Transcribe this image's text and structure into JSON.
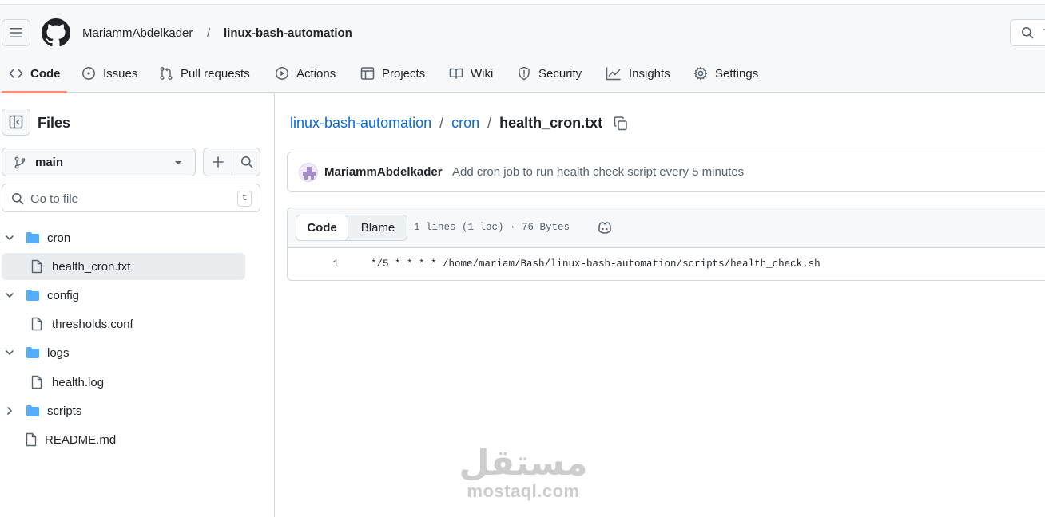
{
  "header": {
    "owner": "MariammAbdelkader",
    "separator": "/",
    "repo": "linux-bash-automation",
    "search_hint": "T"
  },
  "tabs": [
    {
      "label": "Code",
      "icon": "code-icon",
      "active": true
    },
    {
      "label": "Issues",
      "icon": "issue-opened-icon"
    },
    {
      "label": "Pull requests",
      "icon": "git-pull-request-icon"
    },
    {
      "label": "Actions",
      "icon": "play-icon"
    },
    {
      "label": "Projects",
      "icon": "table-icon"
    },
    {
      "label": "Wiki",
      "icon": "book-icon"
    },
    {
      "label": "Security",
      "icon": "shield-icon"
    },
    {
      "label": "Insights",
      "icon": "graph-icon"
    },
    {
      "label": "Settings",
      "icon": "gear-icon"
    }
  ],
  "sidebar": {
    "title": "Files",
    "branch": "main",
    "goto_placeholder": "Go to file",
    "goto_shortcut": "t",
    "tree": [
      {
        "label": "cron",
        "type": "folder",
        "expanded": true
      },
      {
        "label": "health_cron.txt",
        "type": "file",
        "selected": true
      },
      {
        "label": "config",
        "type": "folder",
        "expanded": true
      },
      {
        "label": "thresholds.conf",
        "type": "file"
      },
      {
        "label": "logs",
        "type": "folder",
        "expanded": true
      },
      {
        "label": "health.log",
        "type": "file"
      },
      {
        "label": "scripts",
        "type": "folder",
        "expanded": false
      },
      {
        "label": "README.md",
        "type": "file"
      }
    ]
  },
  "main": {
    "breadcrumb": {
      "repo": "linux-bash-automation",
      "folder": "cron",
      "file": "health_cron.txt",
      "separator": "/"
    },
    "commit": {
      "author": "MariammAbdelkader",
      "message": "Add cron job to run health check script every 5 minutes"
    },
    "file_view": {
      "code_tab": "Code",
      "blame_tab": "Blame",
      "meta": "1 lines (1 loc) · 76 Bytes",
      "lines": [
        {
          "number": "1",
          "text": "*/5 * * * * /home/mariam/Bash/linux-bash-automation/scripts/health_check.sh"
        }
      ]
    }
  },
  "watermark": {
    "arabic": "مستقل",
    "latin": "mostaql.com"
  },
  "colors": {
    "link": "#0969da",
    "folder": "#54aeff",
    "tab_underline": "#fd8c73",
    "header_bg": "#f6f8fa",
    "border": "#d1d9e0"
  }
}
